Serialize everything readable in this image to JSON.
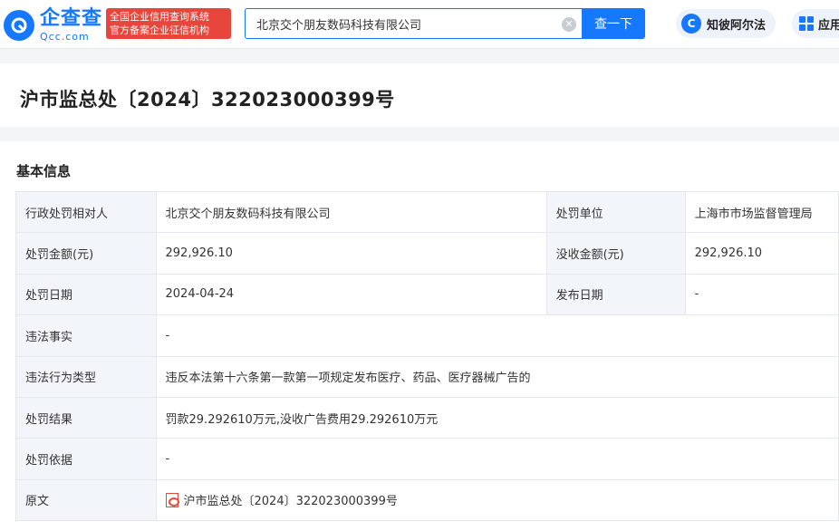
{
  "header": {
    "logo_cn": "企查查",
    "logo_en": "Qcc.com",
    "badge_line1": "全国企业信用查询系统",
    "badge_line2": "官方备案企业征信机构",
    "search_value": "北京交个朋友数码科技有限公司",
    "search_button": "查一下",
    "zbef_label": "知彼阿尔法",
    "app_label": "应用"
  },
  "document": {
    "title": "沪市监总处〔2024〕322023000399号"
  },
  "basic_info": {
    "section_title": "基本信息",
    "rows": [
      {
        "label": "行政处罚相对人",
        "value": "北京交个朋友数码科技有限公司",
        "label2": "处罚单位",
        "value2": "上海市市场监督管理局"
      },
      {
        "label": "处罚金额(元)",
        "value": "292,926.10",
        "label2": "没收金额(元)",
        "value2": "292,926.10"
      },
      {
        "label": "处罚日期",
        "value": "2024-04-24",
        "label2": "发布日期",
        "value2": "-"
      },
      {
        "label": "违法事实",
        "value": "-"
      },
      {
        "label": "违法行为类型",
        "value": "违反本法第十六条第一款第一项规定发布医疗、药品、医疗器械广告的"
      },
      {
        "label": "处罚结果",
        "value": "罚款29.292610万元,没收广告费用29.292610万元"
      },
      {
        "label": "处罚依据",
        "value": "-"
      },
      {
        "label": "原文",
        "value": "沪市监总处〔2024〕322023000399号"
      }
    ]
  },
  "colors": {
    "brand": "#1677ff",
    "badge": "#e8453c",
    "label_bg": "#f2f5fa"
  },
  "icons": [
    "logo-icon",
    "clear-icon",
    "zbef-icon",
    "app-grid-icon",
    "pdf-icon"
  ]
}
